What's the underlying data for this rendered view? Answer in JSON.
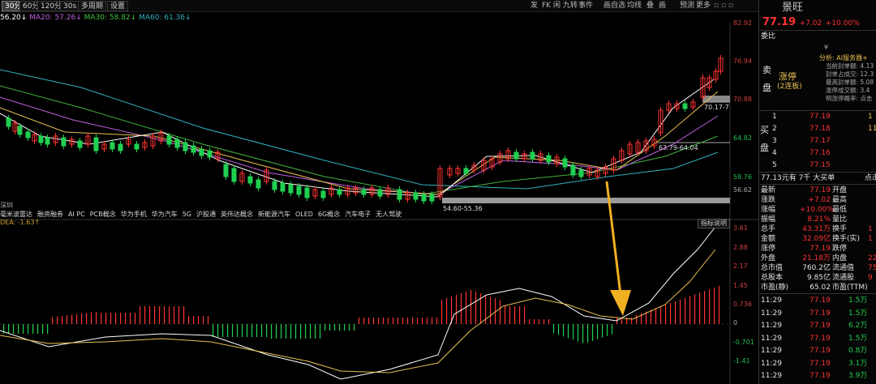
{
  "toolbar": {
    "periods": [
      "30分",
      "60分",
      "120分",
      "30s",
      "多周期",
      "设置"
    ],
    "right_items": [
      "发",
      "FK",
      "闲",
      "九转",
      "事件",
      "画自选",
      "均线",
      "叠",
      "画",
      "预测",
      "更多"
    ]
  },
  "ma": {
    "ma5": "56.20↓",
    "ma20": "MA20: 57.26↓",
    "ma30": "MA30: 58.82↓",
    "ma60": "MA60: 61.36↓"
  },
  "price_axis": [
    "82.92",
    "76.94",
    "70.88",
    "64.82",
    "58.76",
    "56.62"
  ],
  "annotations": {
    "upper_zone": "70.17-7",
    "middle_zone": "63.79-64.04",
    "lower_zone": "54.60-55.36"
  },
  "concept_prefix": "深圳",
  "concepts": [
    "毫米波雷达",
    "融资融券",
    "AI PC",
    "PCB概念",
    "华为手机",
    "华为汽车",
    "5G",
    "沪股通",
    "英伟达概念",
    "新能源汽车",
    "OLED",
    "6G概念",
    "汽车电子",
    "无人驾驶"
  ],
  "indicator": {
    "dea_label": "DEA: -1.63↑",
    "explain_button": "指标说明",
    "axis": [
      "3.61",
      "2.88",
      "2.17",
      "1.45",
      "0.736",
      "0",
      "-0.701",
      "-1.41"
    ]
  },
  "quote": {
    "name": "景旺",
    "price": "77.19",
    "change": "+7.02",
    "pct": "+10.00%",
    "weibi_label": "委比",
    "sell_label": "卖盘",
    "buy_label": "买盘",
    "limit_up": "涨停",
    "limit_up_sub": "(2连板)",
    "analysis_title": "分析: AI服务器+",
    "analysis_rows": [
      "当前封单额: 4.13",
      "封单占成交: 12.3",
      "最高封单额: 5.08",
      "涨停成交额: 3.4",
      "明涨停概率: 点击"
    ],
    "bids": [
      {
        "level": "1",
        "price": "77.19",
        "vol": "1"
      },
      {
        "level": "2",
        "price": "77.18",
        "vol": "11"
      },
      {
        "level": "3",
        "price": "77.17",
        "vol": ""
      },
      {
        "level": "4",
        "price": "77.16",
        "vol": ""
      },
      {
        "level": "5",
        "price": "77.15",
        "vol": ""
      }
    ],
    "big_order": "77.13元有 7千 大买单",
    "big_order_link": "点击",
    "stats": [
      [
        "最新",
        "77.19",
        "开盘",
        ""
      ],
      [
        "涨跌",
        "+7.02",
        "最高",
        ""
      ],
      [
        "涨幅",
        "+10.00%",
        "最低",
        ""
      ],
      [
        "振幅",
        "8.21%",
        "量比",
        ""
      ],
      [
        "总手",
        "43.31万",
        "换手",
        "1"
      ],
      [
        "金额",
        "32.09亿",
        "换手(实)",
        "1"
      ],
      [
        "涨停",
        "77.19",
        "跌停",
        ""
      ],
      [
        "外盘",
        "21.18万",
        "内盘",
        "22"
      ],
      [
        "总市值",
        "760.2亿",
        "流通值",
        "75"
      ],
      [
        "总股本",
        "9.85亿",
        "流通股",
        "9"
      ],
      [
        "市盈(静)",
        "65.02",
        "市盈(TTM)",
        ""
      ]
    ],
    "ticks": [
      {
        "time": "11:29",
        "price": "77.19",
        "vol": "1.5万"
      },
      {
        "time": "11:29",
        "price": "77.19",
        "vol": "1.5万"
      },
      {
        "time": "11:29",
        "price": "77.19",
        "vol": "6.2万"
      },
      {
        "time": "11:29",
        "price": "77.19",
        "vol": "1.5万"
      },
      {
        "time": "11:29",
        "price": "77.19",
        "vol": "0.8万"
      },
      {
        "time": "11:29",
        "price": "77.19",
        "vol": "3.1万"
      },
      {
        "time": "11:29",
        "price": "77.19",
        "vol": "3.9万"
      }
    ]
  },
  "colors": {
    "up": "#ff3232",
    "down": "#20d050",
    "ma_white": "#ffffff",
    "ma_yellow": "#e8c050",
    "ma_purple": "#c060e0",
    "ma_green": "#40b040",
    "ma_cyan": "#30b0c0",
    "arrow": "#f0b020"
  }
}
